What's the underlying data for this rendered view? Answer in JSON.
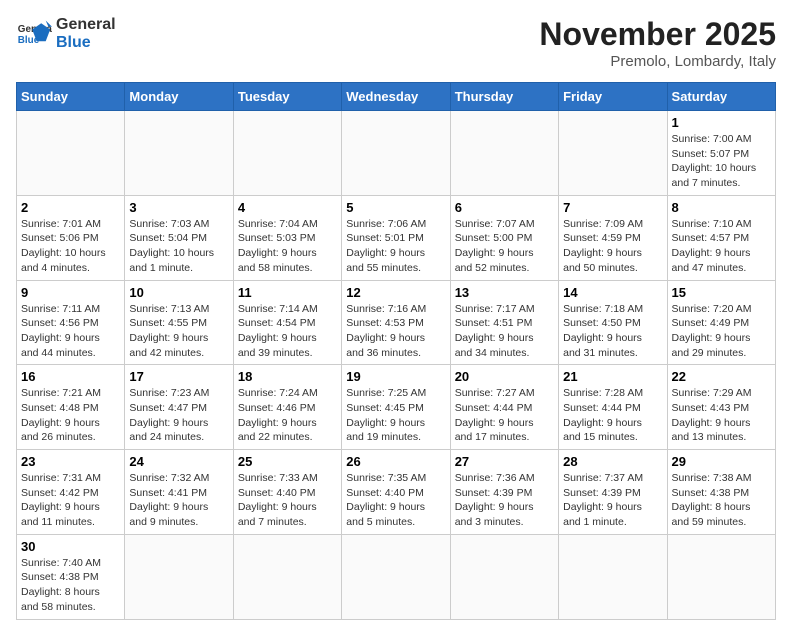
{
  "header": {
    "logo_general": "General",
    "logo_blue": "Blue",
    "month": "November 2025",
    "location": "Premolo, Lombardy, Italy"
  },
  "weekdays": [
    "Sunday",
    "Monday",
    "Tuesday",
    "Wednesday",
    "Thursday",
    "Friday",
    "Saturday"
  ],
  "weeks": [
    [
      {
        "day": "",
        "info": ""
      },
      {
        "day": "",
        "info": ""
      },
      {
        "day": "",
        "info": ""
      },
      {
        "day": "",
        "info": ""
      },
      {
        "day": "",
        "info": ""
      },
      {
        "day": "",
        "info": ""
      },
      {
        "day": "1",
        "info": "Sunrise: 7:00 AM\nSunset: 5:07 PM\nDaylight: 10 hours\nand 7 minutes."
      }
    ],
    [
      {
        "day": "2",
        "info": "Sunrise: 7:01 AM\nSunset: 5:06 PM\nDaylight: 10 hours\nand 4 minutes."
      },
      {
        "day": "3",
        "info": "Sunrise: 7:03 AM\nSunset: 5:04 PM\nDaylight: 10 hours\nand 1 minute."
      },
      {
        "day": "4",
        "info": "Sunrise: 7:04 AM\nSunset: 5:03 PM\nDaylight: 9 hours\nand 58 minutes."
      },
      {
        "day": "5",
        "info": "Sunrise: 7:06 AM\nSunset: 5:01 PM\nDaylight: 9 hours\nand 55 minutes."
      },
      {
        "day": "6",
        "info": "Sunrise: 7:07 AM\nSunset: 5:00 PM\nDaylight: 9 hours\nand 52 minutes."
      },
      {
        "day": "7",
        "info": "Sunrise: 7:09 AM\nSunset: 4:59 PM\nDaylight: 9 hours\nand 50 minutes."
      },
      {
        "day": "8",
        "info": "Sunrise: 7:10 AM\nSunset: 4:57 PM\nDaylight: 9 hours\nand 47 minutes."
      }
    ],
    [
      {
        "day": "9",
        "info": "Sunrise: 7:11 AM\nSunset: 4:56 PM\nDaylight: 9 hours\nand 44 minutes."
      },
      {
        "day": "10",
        "info": "Sunrise: 7:13 AM\nSunset: 4:55 PM\nDaylight: 9 hours\nand 42 minutes."
      },
      {
        "day": "11",
        "info": "Sunrise: 7:14 AM\nSunset: 4:54 PM\nDaylight: 9 hours\nand 39 minutes."
      },
      {
        "day": "12",
        "info": "Sunrise: 7:16 AM\nSunset: 4:53 PM\nDaylight: 9 hours\nand 36 minutes."
      },
      {
        "day": "13",
        "info": "Sunrise: 7:17 AM\nSunset: 4:51 PM\nDaylight: 9 hours\nand 34 minutes."
      },
      {
        "day": "14",
        "info": "Sunrise: 7:18 AM\nSunset: 4:50 PM\nDaylight: 9 hours\nand 31 minutes."
      },
      {
        "day": "15",
        "info": "Sunrise: 7:20 AM\nSunset: 4:49 PM\nDaylight: 9 hours\nand 29 minutes."
      }
    ],
    [
      {
        "day": "16",
        "info": "Sunrise: 7:21 AM\nSunset: 4:48 PM\nDaylight: 9 hours\nand 26 minutes."
      },
      {
        "day": "17",
        "info": "Sunrise: 7:23 AM\nSunset: 4:47 PM\nDaylight: 9 hours\nand 24 minutes."
      },
      {
        "day": "18",
        "info": "Sunrise: 7:24 AM\nSunset: 4:46 PM\nDaylight: 9 hours\nand 22 minutes."
      },
      {
        "day": "19",
        "info": "Sunrise: 7:25 AM\nSunset: 4:45 PM\nDaylight: 9 hours\nand 19 minutes."
      },
      {
        "day": "20",
        "info": "Sunrise: 7:27 AM\nSunset: 4:44 PM\nDaylight: 9 hours\nand 17 minutes."
      },
      {
        "day": "21",
        "info": "Sunrise: 7:28 AM\nSunset: 4:44 PM\nDaylight: 9 hours\nand 15 minutes."
      },
      {
        "day": "22",
        "info": "Sunrise: 7:29 AM\nSunset: 4:43 PM\nDaylight: 9 hours\nand 13 minutes."
      }
    ],
    [
      {
        "day": "23",
        "info": "Sunrise: 7:31 AM\nSunset: 4:42 PM\nDaylight: 9 hours\nand 11 minutes."
      },
      {
        "day": "24",
        "info": "Sunrise: 7:32 AM\nSunset: 4:41 PM\nDaylight: 9 hours\nand 9 minutes."
      },
      {
        "day": "25",
        "info": "Sunrise: 7:33 AM\nSunset: 4:40 PM\nDaylight: 9 hours\nand 7 minutes."
      },
      {
        "day": "26",
        "info": "Sunrise: 7:35 AM\nSunset: 4:40 PM\nDaylight: 9 hours\nand 5 minutes."
      },
      {
        "day": "27",
        "info": "Sunrise: 7:36 AM\nSunset: 4:39 PM\nDaylight: 9 hours\nand 3 minutes."
      },
      {
        "day": "28",
        "info": "Sunrise: 7:37 AM\nSunset: 4:39 PM\nDaylight: 9 hours\nand 1 minute."
      },
      {
        "day": "29",
        "info": "Sunrise: 7:38 AM\nSunset: 4:38 PM\nDaylight: 8 hours\nand 59 minutes."
      }
    ],
    [
      {
        "day": "30",
        "info": "Sunrise: 7:40 AM\nSunset: 4:38 PM\nDaylight: 8 hours\nand 58 minutes."
      },
      {
        "day": "",
        "info": ""
      },
      {
        "day": "",
        "info": ""
      },
      {
        "day": "",
        "info": ""
      },
      {
        "day": "",
        "info": ""
      },
      {
        "day": "",
        "info": ""
      },
      {
        "day": "",
        "info": ""
      }
    ]
  ]
}
